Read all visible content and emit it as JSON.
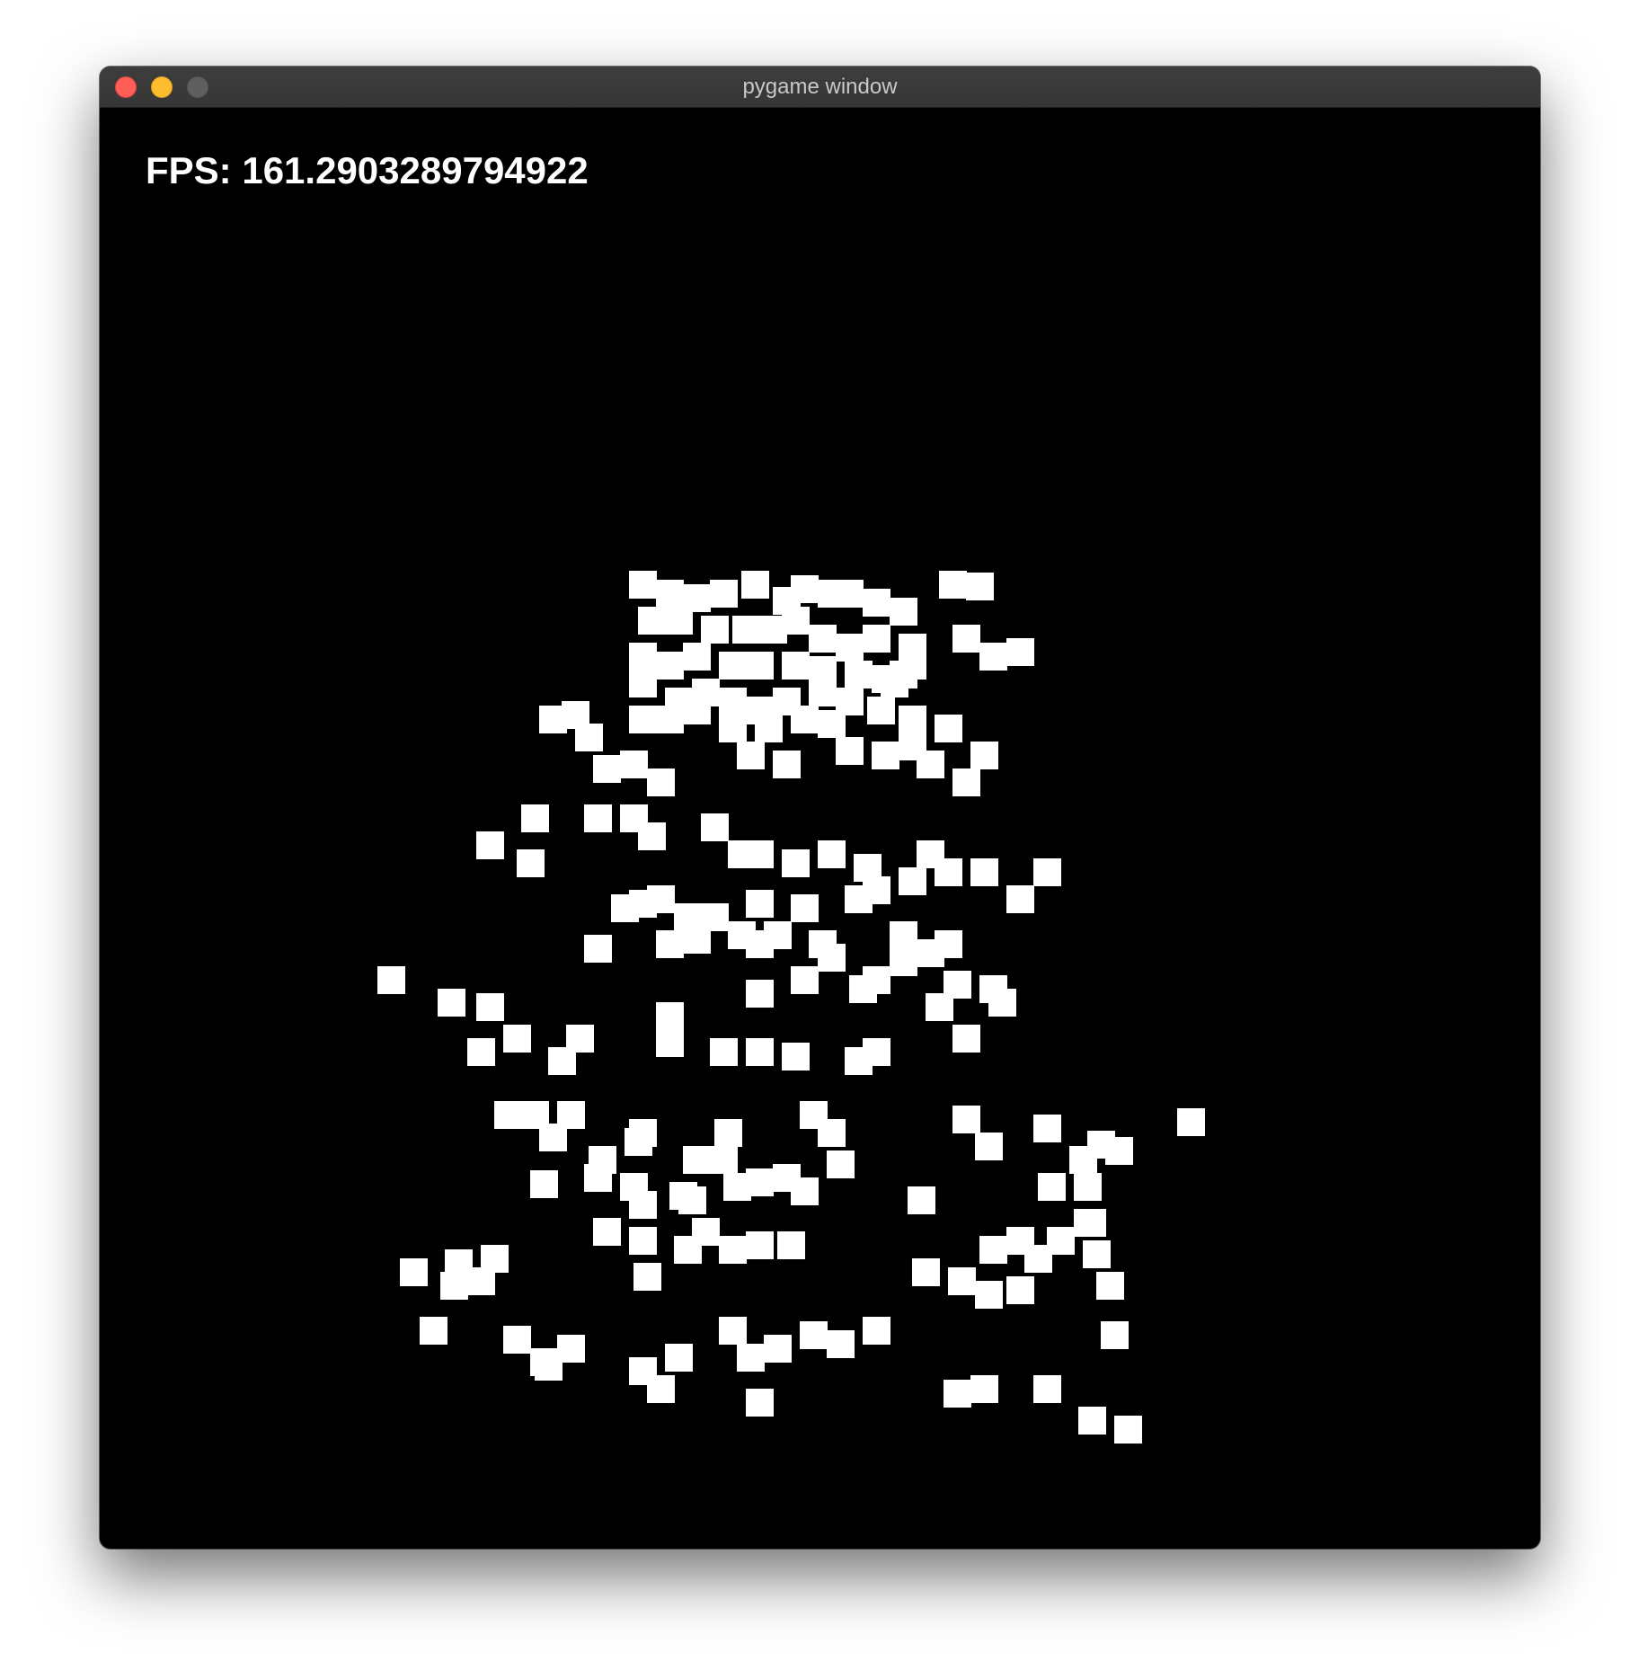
{
  "window": {
    "title": "pygame window",
    "controls": [
      "close-button",
      "minimize-button",
      "zoom-button"
    ]
  },
  "game": {
    "fps_text": "FPS: 161.2903289794922",
    "background_color": "#000000",
    "particle_color": "#ffffff"
  }
}
